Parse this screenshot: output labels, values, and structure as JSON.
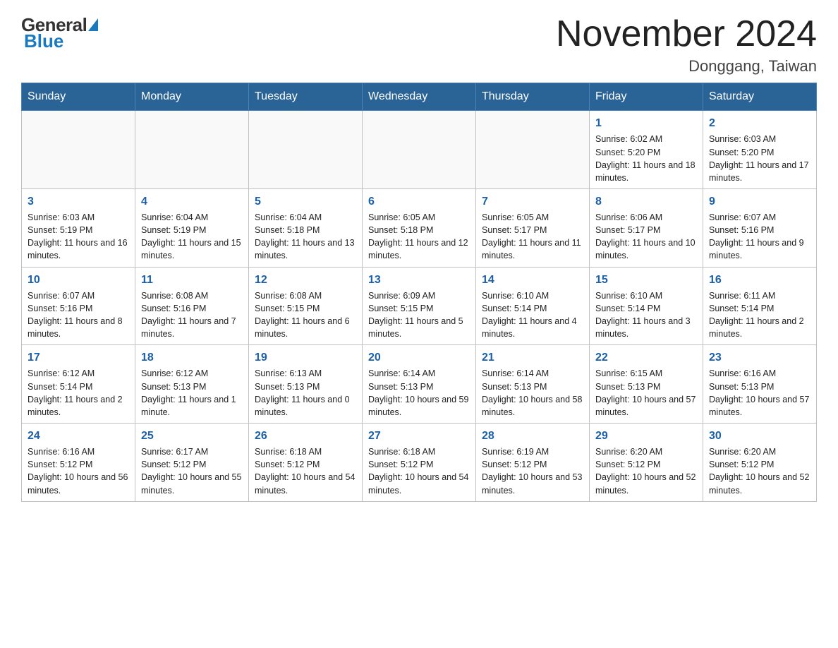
{
  "header": {
    "logo_general": "General",
    "logo_blue": "Blue",
    "month_title": "November 2024",
    "location": "Donggang, Taiwan"
  },
  "days_of_week": [
    "Sunday",
    "Monday",
    "Tuesday",
    "Wednesday",
    "Thursday",
    "Friday",
    "Saturday"
  ],
  "weeks": [
    [
      {
        "day": "",
        "info": ""
      },
      {
        "day": "",
        "info": ""
      },
      {
        "day": "",
        "info": ""
      },
      {
        "day": "",
        "info": ""
      },
      {
        "day": "",
        "info": ""
      },
      {
        "day": "1",
        "info": "Sunrise: 6:02 AM\nSunset: 5:20 PM\nDaylight: 11 hours and 18 minutes."
      },
      {
        "day": "2",
        "info": "Sunrise: 6:03 AM\nSunset: 5:20 PM\nDaylight: 11 hours and 17 minutes."
      }
    ],
    [
      {
        "day": "3",
        "info": "Sunrise: 6:03 AM\nSunset: 5:19 PM\nDaylight: 11 hours and 16 minutes."
      },
      {
        "day": "4",
        "info": "Sunrise: 6:04 AM\nSunset: 5:19 PM\nDaylight: 11 hours and 15 minutes."
      },
      {
        "day": "5",
        "info": "Sunrise: 6:04 AM\nSunset: 5:18 PM\nDaylight: 11 hours and 13 minutes."
      },
      {
        "day": "6",
        "info": "Sunrise: 6:05 AM\nSunset: 5:18 PM\nDaylight: 11 hours and 12 minutes."
      },
      {
        "day": "7",
        "info": "Sunrise: 6:05 AM\nSunset: 5:17 PM\nDaylight: 11 hours and 11 minutes."
      },
      {
        "day": "8",
        "info": "Sunrise: 6:06 AM\nSunset: 5:17 PM\nDaylight: 11 hours and 10 minutes."
      },
      {
        "day": "9",
        "info": "Sunrise: 6:07 AM\nSunset: 5:16 PM\nDaylight: 11 hours and 9 minutes."
      }
    ],
    [
      {
        "day": "10",
        "info": "Sunrise: 6:07 AM\nSunset: 5:16 PM\nDaylight: 11 hours and 8 minutes."
      },
      {
        "day": "11",
        "info": "Sunrise: 6:08 AM\nSunset: 5:16 PM\nDaylight: 11 hours and 7 minutes."
      },
      {
        "day": "12",
        "info": "Sunrise: 6:08 AM\nSunset: 5:15 PM\nDaylight: 11 hours and 6 minutes."
      },
      {
        "day": "13",
        "info": "Sunrise: 6:09 AM\nSunset: 5:15 PM\nDaylight: 11 hours and 5 minutes."
      },
      {
        "day": "14",
        "info": "Sunrise: 6:10 AM\nSunset: 5:14 PM\nDaylight: 11 hours and 4 minutes."
      },
      {
        "day": "15",
        "info": "Sunrise: 6:10 AM\nSunset: 5:14 PM\nDaylight: 11 hours and 3 minutes."
      },
      {
        "day": "16",
        "info": "Sunrise: 6:11 AM\nSunset: 5:14 PM\nDaylight: 11 hours and 2 minutes."
      }
    ],
    [
      {
        "day": "17",
        "info": "Sunrise: 6:12 AM\nSunset: 5:14 PM\nDaylight: 11 hours and 2 minutes."
      },
      {
        "day": "18",
        "info": "Sunrise: 6:12 AM\nSunset: 5:13 PM\nDaylight: 11 hours and 1 minute."
      },
      {
        "day": "19",
        "info": "Sunrise: 6:13 AM\nSunset: 5:13 PM\nDaylight: 11 hours and 0 minutes."
      },
      {
        "day": "20",
        "info": "Sunrise: 6:14 AM\nSunset: 5:13 PM\nDaylight: 10 hours and 59 minutes."
      },
      {
        "day": "21",
        "info": "Sunrise: 6:14 AM\nSunset: 5:13 PM\nDaylight: 10 hours and 58 minutes."
      },
      {
        "day": "22",
        "info": "Sunrise: 6:15 AM\nSunset: 5:13 PM\nDaylight: 10 hours and 57 minutes."
      },
      {
        "day": "23",
        "info": "Sunrise: 6:16 AM\nSunset: 5:13 PM\nDaylight: 10 hours and 57 minutes."
      }
    ],
    [
      {
        "day": "24",
        "info": "Sunrise: 6:16 AM\nSunset: 5:12 PM\nDaylight: 10 hours and 56 minutes."
      },
      {
        "day": "25",
        "info": "Sunrise: 6:17 AM\nSunset: 5:12 PM\nDaylight: 10 hours and 55 minutes."
      },
      {
        "day": "26",
        "info": "Sunrise: 6:18 AM\nSunset: 5:12 PM\nDaylight: 10 hours and 54 minutes."
      },
      {
        "day": "27",
        "info": "Sunrise: 6:18 AM\nSunset: 5:12 PM\nDaylight: 10 hours and 54 minutes."
      },
      {
        "day": "28",
        "info": "Sunrise: 6:19 AM\nSunset: 5:12 PM\nDaylight: 10 hours and 53 minutes."
      },
      {
        "day": "29",
        "info": "Sunrise: 6:20 AM\nSunset: 5:12 PM\nDaylight: 10 hours and 52 minutes."
      },
      {
        "day": "30",
        "info": "Sunrise: 6:20 AM\nSunset: 5:12 PM\nDaylight: 10 hours and 52 minutes."
      }
    ]
  ]
}
